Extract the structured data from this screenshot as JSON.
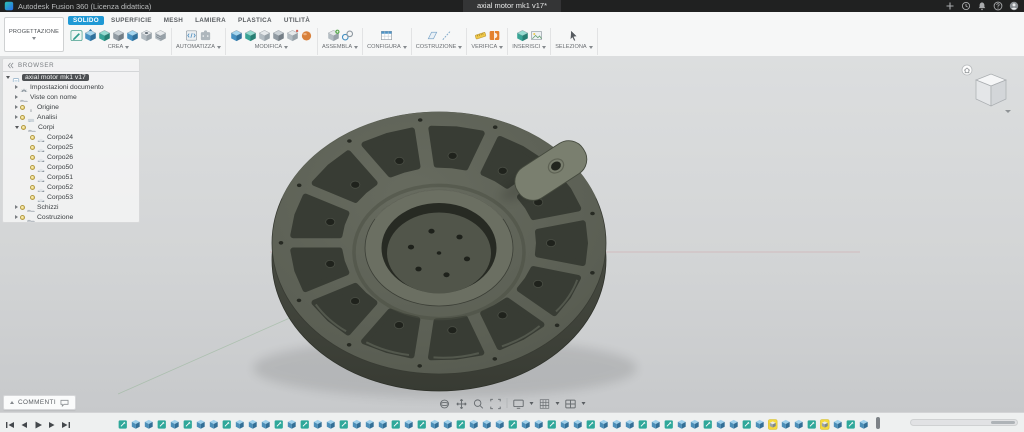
{
  "titlebar": {
    "app_title": "Autodesk Fusion 360 (Licenza didattica)",
    "document_tab": "axial motor mk1 v17*"
  },
  "workspace_selector": {
    "label": "PROGETTAZIONE"
  },
  "ribbon": {
    "tabs": [
      {
        "label": "SOLIDO",
        "active": true
      },
      {
        "label": "SUPERFICIE",
        "active": false
      },
      {
        "label": "MESH",
        "active": false
      },
      {
        "label": "LAMIERA",
        "active": false
      },
      {
        "label": "PLASTICA",
        "active": false
      },
      {
        "label": "UTILITÀ",
        "active": false
      }
    ],
    "groups": [
      {
        "label": "CREA",
        "icons": [
          "create-sketch",
          "extrude",
          "revolve",
          "sweep",
          "loft",
          "hole",
          "thread"
        ]
      },
      {
        "label": "AUTOMATIZZA",
        "icons": [
          "script",
          "add-in"
        ]
      },
      {
        "label": "MODIFICA",
        "icons": [
          "press-pull",
          "fillet",
          "shell",
          "combine",
          "move-copy",
          "physical-material"
        ]
      },
      {
        "label": "ASSEMBLA",
        "icons": [
          "new-component",
          "joint"
        ]
      },
      {
        "label": "CONFIGURA",
        "icons": [
          "configuration"
        ]
      },
      {
        "label": "COSTRUZIONE",
        "icons": [
          "construction-plane",
          "construction-axis"
        ]
      },
      {
        "label": "VERIFICA",
        "icons": [
          "measure",
          "section-analysis"
        ]
      },
      {
        "label": "INSERISCI",
        "icons": [
          "insert-mesh",
          "insert-canvas"
        ]
      },
      {
        "label": "SELEZIONA",
        "icons": [
          "select"
        ]
      }
    ]
  },
  "browser": {
    "header": "BROWSER",
    "tree": [
      {
        "label": "axial motor mk1 v17",
        "indent": 0,
        "arrow": "expanded",
        "bulb": false,
        "icon": "document",
        "selected": true
      },
      {
        "label": "Impostazioni documento",
        "indent": 1,
        "arrow": "collapsed",
        "bulb": false,
        "icon": "settings",
        "selected": false
      },
      {
        "label": "Viste con nome",
        "indent": 1,
        "arrow": "collapsed",
        "bulb": false,
        "icon": "views",
        "selected": false
      },
      {
        "label": "Origine",
        "indent": 1,
        "arrow": "collapsed",
        "bulb": true,
        "icon": "origin",
        "selected": false
      },
      {
        "label": "Analisi",
        "indent": 1,
        "arrow": "collapsed",
        "bulb": true,
        "icon": "analysis",
        "selected": false
      },
      {
        "label": "Corpi",
        "indent": 1,
        "arrow": "expanded",
        "bulb": true,
        "icon": "bodies",
        "selected": false
      },
      {
        "label": "Corpo24",
        "indent": 2,
        "arrow": "none",
        "bulb": true,
        "icon": "body",
        "selected": false
      },
      {
        "label": "Corpo25",
        "indent": 2,
        "arrow": "none",
        "bulb": true,
        "icon": "body",
        "selected": false
      },
      {
        "label": "Corpo26",
        "indent": 2,
        "arrow": "none",
        "bulb": true,
        "icon": "body",
        "selected": false
      },
      {
        "label": "Corpo50",
        "indent": 2,
        "arrow": "none",
        "bulb": true,
        "icon": "body",
        "selected": false
      },
      {
        "label": "Corpo51",
        "indent": 2,
        "arrow": "none",
        "bulb": true,
        "icon": "body",
        "selected": false
      },
      {
        "label": "Corpo52",
        "indent": 2,
        "arrow": "none",
        "bulb": true,
        "icon": "body",
        "selected": false
      },
      {
        "label": "Corpo53",
        "indent": 2,
        "arrow": "none",
        "bulb": true,
        "icon": "body",
        "selected": false
      },
      {
        "label": "Schizzi",
        "indent": 1,
        "arrow": "collapsed",
        "bulb": true,
        "icon": "sketches",
        "selected": false
      },
      {
        "label": "Costruzione",
        "indent": 1,
        "arrow": "collapsed",
        "bulb": true,
        "icon": "construction",
        "selected": false
      }
    ]
  },
  "viewport": {
    "nav_icons": [
      "orbit",
      "pan",
      "zoom",
      "fit",
      "display-settings",
      "grid-settings",
      "viewports"
    ]
  },
  "comments": {
    "label": "COMMENTI"
  },
  "timeline": {
    "controls": [
      "skip-start",
      "step-back",
      "play",
      "step-forward",
      "skip-end"
    ],
    "legend": {
      "s": "sketch",
      "e": "feature",
      "w": "feature-warning"
    },
    "features": [
      "s",
      "e",
      "e",
      "s",
      "e",
      "s",
      "e",
      "e",
      "s",
      "e",
      "e",
      "e",
      "s",
      "e",
      "s",
      "e",
      "e",
      "s",
      "e",
      "e",
      "e",
      "s",
      "e",
      "s",
      "e",
      "e",
      "s",
      "e",
      "e",
      "e",
      "s",
      "e",
      "e",
      "s",
      "e",
      "e",
      "s",
      "e",
      "e",
      "e",
      "s",
      "e",
      "s",
      "e",
      "e",
      "s",
      "e",
      "e",
      "s",
      "e",
      "w",
      "e",
      "e",
      "s",
      "w",
      "e",
      "s",
      "e"
    ]
  },
  "colors": {
    "accent_blue": "#0696d7",
    "model_gray": "#5d6156",
    "warning_yellow": "#f4d93b",
    "viewport_gray": "#d3d5d6"
  }
}
